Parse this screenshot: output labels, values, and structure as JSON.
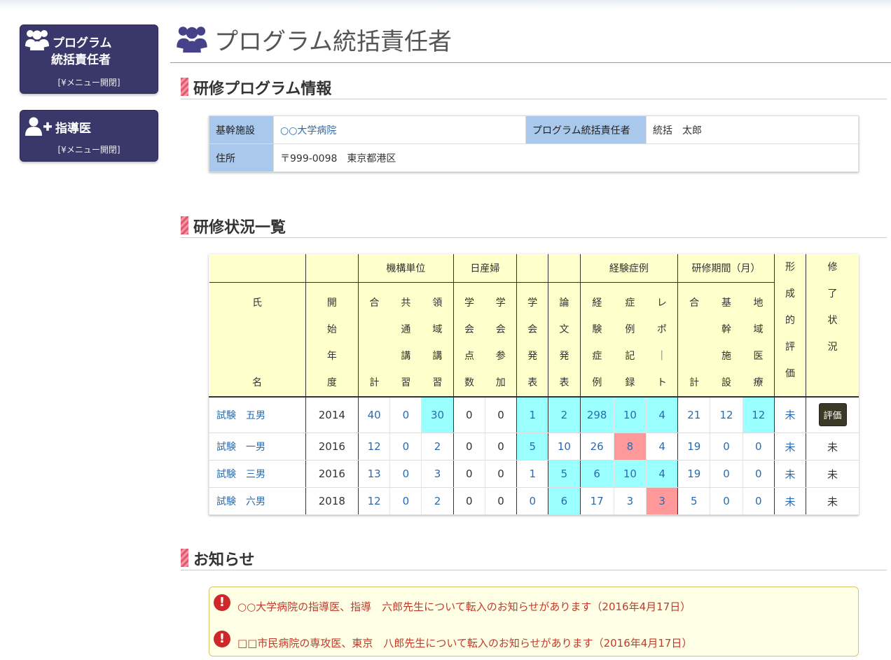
{
  "sidebar": {
    "program": {
      "line1": "プログラム",
      "line2": "統括責任者",
      "toggle": "[¥メニュー開閉]",
      "icon": "users-icon"
    },
    "instructor": {
      "title": "指導医",
      "toggle": "[¥メニュー開閉]",
      "icon": "user-plus-icon"
    }
  },
  "page": {
    "title": "プログラム統括責任者",
    "icon": "users-icon"
  },
  "sections": {
    "info": "研修プログラム情報",
    "status": "研修状況一覧",
    "notices": "お知らせ"
  },
  "info": {
    "base_label": "基幹施設",
    "base_value": "○○大学病院",
    "head_label": "プログラム統括責任者",
    "head_value": "統括　太郎",
    "address_label": "住所",
    "address_value": "〒999-0098　東京都港区"
  },
  "status_table": {
    "groups": {
      "kiko": "機構単位",
      "nissanpu": "日産婦",
      "keiken": "経験症例",
      "kikan": "研修期間（月）"
    },
    "headers": {
      "name": [
        "氏",
        "名"
      ],
      "start": [
        "開",
        "始",
        "年",
        "度"
      ],
      "kiko_total": [
        "合",
        "計"
      ],
      "kiko_common": [
        "共",
        "通",
        "講",
        "習"
      ],
      "kiko_field": [
        "領",
        "域",
        "講",
        "習"
      ],
      "nis_points": [
        "学",
        "会",
        "点",
        "数"
      ],
      "nis_attend": [
        "学",
        "会",
        "参",
        "加"
      ],
      "present": [
        "学",
        "会",
        "発",
        "表"
      ],
      "paper": [
        "論",
        "文",
        "発",
        "表"
      ],
      "exp_cases": [
        "経",
        "験",
        "症",
        "例"
      ],
      "case_records": [
        "症",
        "例",
        "記",
        "録"
      ],
      "report": [
        "レ",
        "ポ",
        "｜",
        "ト"
      ],
      "period_total": [
        "合",
        "計"
      ],
      "period_base": [
        "基",
        "幹",
        "施",
        "設"
      ],
      "period_local": [
        "地",
        "域",
        "医",
        "療"
      ],
      "formative": [
        "形",
        "成",
        "的",
        "評",
        "価"
      ],
      "completion": [
        "修",
        "了",
        "状",
        "況"
      ]
    },
    "rows": [
      {
        "name": "試験　五男",
        "year": "2014",
        "kiko_total": "40",
        "kiko_common": "0",
        "kiko_field": "30",
        "nis_points": "0",
        "nis_attend": "0",
        "present": "1",
        "paper": "2",
        "exp_cases": "298",
        "case_records": "10",
        "report": "4",
        "period_total": "21",
        "period_base": "12",
        "period_local": "12",
        "formative": "未",
        "completion": "評価"
      },
      {
        "name": "試験　一男",
        "year": "2016",
        "kiko_total": "12",
        "kiko_common": "0",
        "kiko_field": "2",
        "nis_points": "0",
        "nis_attend": "0",
        "present": "5",
        "paper": "10",
        "exp_cases": "26",
        "case_records": "8",
        "report": "4",
        "period_total": "19",
        "period_base": "0",
        "period_local": "0",
        "formative": "未",
        "completion": "未"
      },
      {
        "name": "試験　三男",
        "year": "2016",
        "kiko_total": "13",
        "kiko_common": "0",
        "kiko_field": "3",
        "nis_points": "0",
        "nis_attend": "0",
        "present": "1",
        "paper": "5",
        "exp_cases": "6",
        "case_records": "10",
        "report": "4",
        "period_total": "19",
        "period_base": "0",
        "period_local": "0",
        "formative": "未",
        "completion": "未"
      },
      {
        "name": "試験　六男",
        "year": "2018",
        "kiko_total": "12",
        "kiko_common": "0",
        "kiko_field": "2",
        "nis_points": "0",
        "nis_attend": "0",
        "present": "0",
        "paper": "6",
        "exp_cases": "17",
        "case_records": "3",
        "report": "3",
        "period_total": "5",
        "period_base": "0",
        "period_local": "0",
        "formative": "未",
        "completion": "未"
      }
    ]
  },
  "notices": [
    {
      "text": "○○大学病院の指導医、指導　六郎先生について転入のお知らせがあります（2016年4月17日）",
      "icon": "exclamation-icon"
    },
    {
      "text": "□□市民病院の専攻医、東京　八郎先生について転入のお知らせがあります（2016年4月17日）",
      "icon": "exclamation-icon"
    }
  ],
  "colors": {
    "sidebar": "#3a376a",
    "header_bg": "#ffffcc",
    "highlight_cyan": "#99ffff",
    "highlight_pink": "#ff9999",
    "label_bg": "#a9c8ec",
    "link": "#2a6bb0",
    "notice_text": "#c0392b"
  }
}
